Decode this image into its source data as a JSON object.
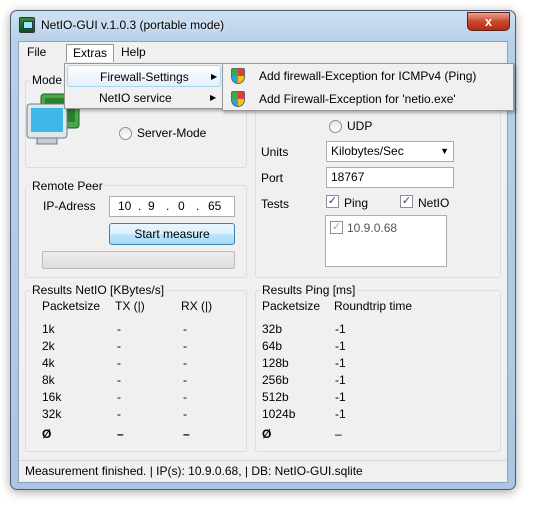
{
  "window": {
    "title": "NetIO-GUI v.1.0.3 (portable mode)",
    "close_glyph": "x"
  },
  "menubar": {
    "file": "File",
    "extras": "Extras",
    "help": "Help"
  },
  "extras_menu": {
    "firewall_settings": "Firewall-Settings",
    "netio_service": "NetIO service"
  },
  "firewall_submenu": {
    "item1": "Add firewall-Exception for ICMPv4 (Ping)",
    "item2": "Add Firewall-Exception for 'netio.exe'"
  },
  "mode": {
    "label": "Mode",
    "server_mode": "Server-Mode"
  },
  "protocol": {
    "udp": "UDP"
  },
  "settings": {
    "units_label": "Units",
    "units_value": "Kilobytes/Sec",
    "port_label": "Port",
    "port_value": "18767",
    "tests_label": "Tests",
    "ping_label": "Ping",
    "netio_label": "NetIO",
    "peers": [
      "10.9.0.68"
    ]
  },
  "remote_peer": {
    "label": "Remote Peer",
    "ip_label": "IP-Adress",
    "ip_octets": [
      "10",
      "9",
      "0",
      "65"
    ],
    "start_button": "Start measure"
  },
  "results_netio": {
    "label": "Results NetIO [KBytes/s]",
    "headers": [
      "Packetsize",
      "TX (|)",
      "RX (|)"
    ],
    "rows": [
      [
        "1k",
        "-",
        "-"
      ],
      [
        "2k",
        "-",
        "-"
      ],
      [
        "4k",
        "-",
        "-"
      ],
      [
        "8k",
        "-",
        "-"
      ],
      [
        "16k",
        "-",
        "-"
      ],
      [
        "32k",
        "-",
        "-"
      ],
      [
        "Ø",
        "–",
        "–"
      ]
    ]
  },
  "results_ping": {
    "label": "Results Ping [ms]",
    "headers": [
      "Packetsize",
      "Roundtrip time"
    ],
    "rows": [
      [
        "32b",
        "-1"
      ],
      [
        "64b",
        "-1"
      ],
      [
        "128b",
        "-1"
      ],
      [
        "256b",
        "-1"
      ],
      [
        "512b",
        "-1"
      ],
      [
        "1024b",
        "-1"
      ],
      [
        "Ø",
        "–"
      ]
    ]
  },
  "statusbar": {
    "text": "Measurement finished.   |   IP(s): 10.9.0.68,   |   DB: NetIO-GUI.sqlite"
  },
  "colors": {
    "accent": "#3c7fb1",
    "menu_hover": "#e3effd"
  }
}
